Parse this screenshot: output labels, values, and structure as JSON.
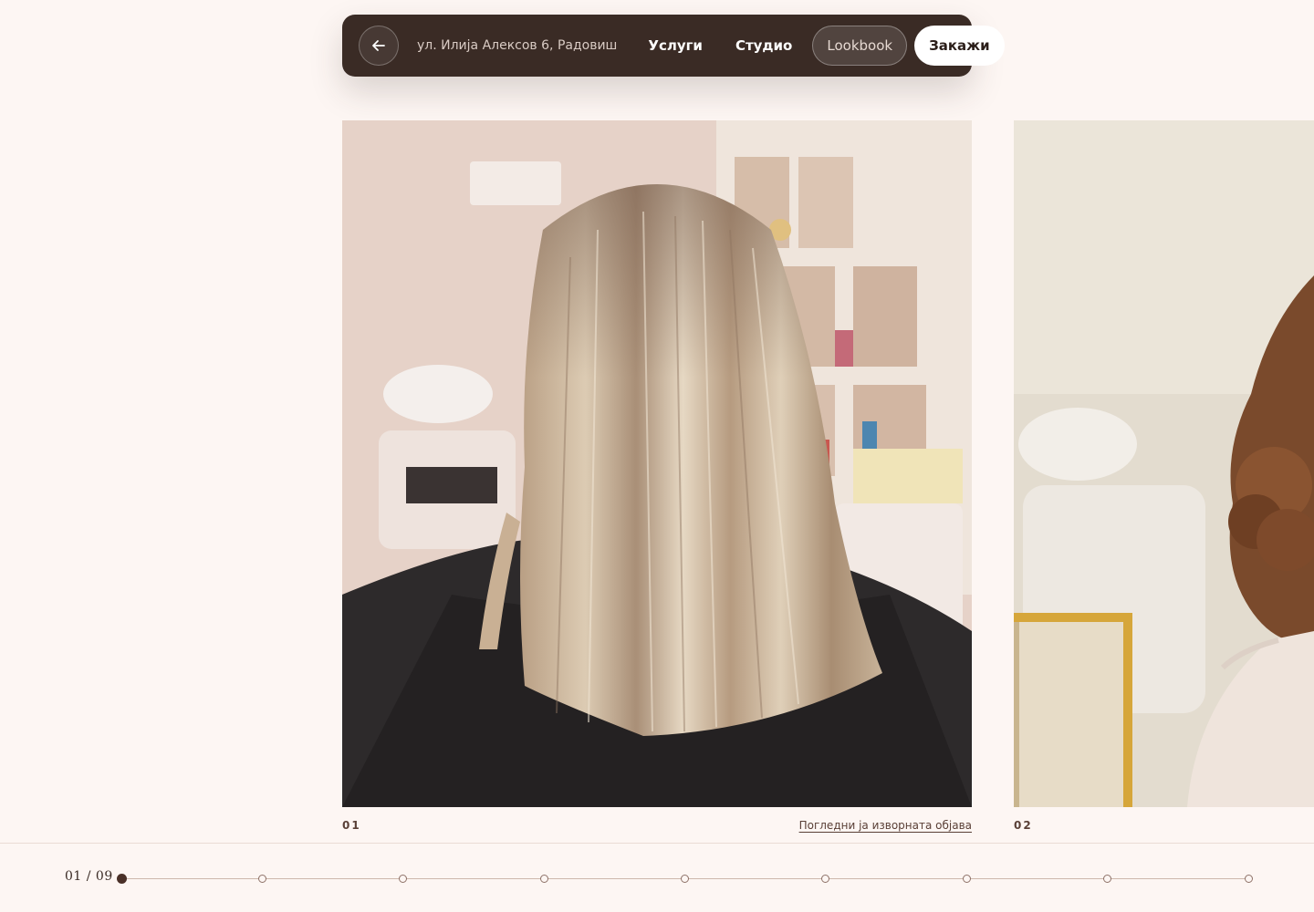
{
  "nav": {
    "back_icon": "arrow-left-icon",
    "address": "ул. Илија Алексов 6, Радовиш",
    "links": [
      {
        "label": "Услуги"
      },
      {
        "label": "Студио"
      }
    ],
    "lookbook_label": "Lookbook",
    "book_label": "Закажи"
  },
  "gallery": {
    "items": [
      {
        "number": "01",
        "link_label": "Погледни ја изворната објава"
      },
      {
        "number": "02"
      }
    ]
  },
  "pager": {
    "counter": "01 / 09",
    "current": 1,
    "total": 9
  },
  "colors": {
    "nav_bg": "#3a2b25",
    "page_bg": "#fdf6f3",
    "accent": "#4a3028"
  }
}
